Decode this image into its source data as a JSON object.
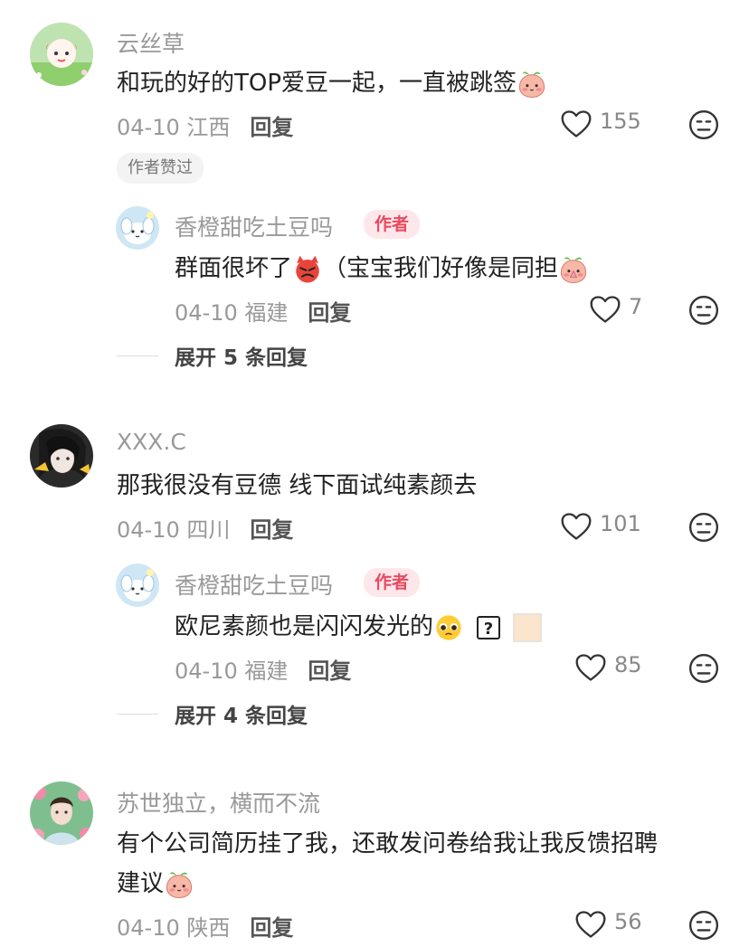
{
  "comments": [
    {
      "name": "云丝草",
      "text": "和玩的好的TOP爱豆一起，一直被跳签",
      "date": "04-10",
      "location": "江西",
      "reply_label": "回复",
      "likes": "155",
      "liked_tag": "作者赞过"
    },
    {
      "name": "XXX.C",
      "text": "那我很没有豆德 线下面试纯素颜去",
      "date": "04-10",
      "location": "四川",
      "reply_label": "回复",
      "likes": "101"
    },
    {
      "name": "苏世独立，横而不流",
      "text_line1": "有个公司简历挂了我，还敢发问卷给我让我反馈招聘",
      "text_line2": "建议",
      "date": "04-10",
      "location": "陕西",
      "reply_label": "回复",
      "likes": "56"
    }
  ],
  "replies": [
    {
      "name": "香橙甜吃土豆吗",
      "author_badge": "作者",
      "text_a": "群面很坏了",
      "text_b": "（宝宝我们好像是同担",
      "date": "04-10",
      "location": "福建",
      "reply_label": "回复",
      "likes": "7",
      "expand": "展开 5 条回复"
    },
    {
      "name": "香橙甜吃土豆吗",
      "author_badge": "作者",
      "text": "欧尼素颜也是闪闪发光的",
      "date": "04-10",
      "location": "福建",
      "reply_label": "回复",
      "likes": "85",
      "expand": "展开 4 条回复"
    }
  ],
  "colors": {
    "accent": "#e84a5f",
    "muted": "#999999"
  }
}
